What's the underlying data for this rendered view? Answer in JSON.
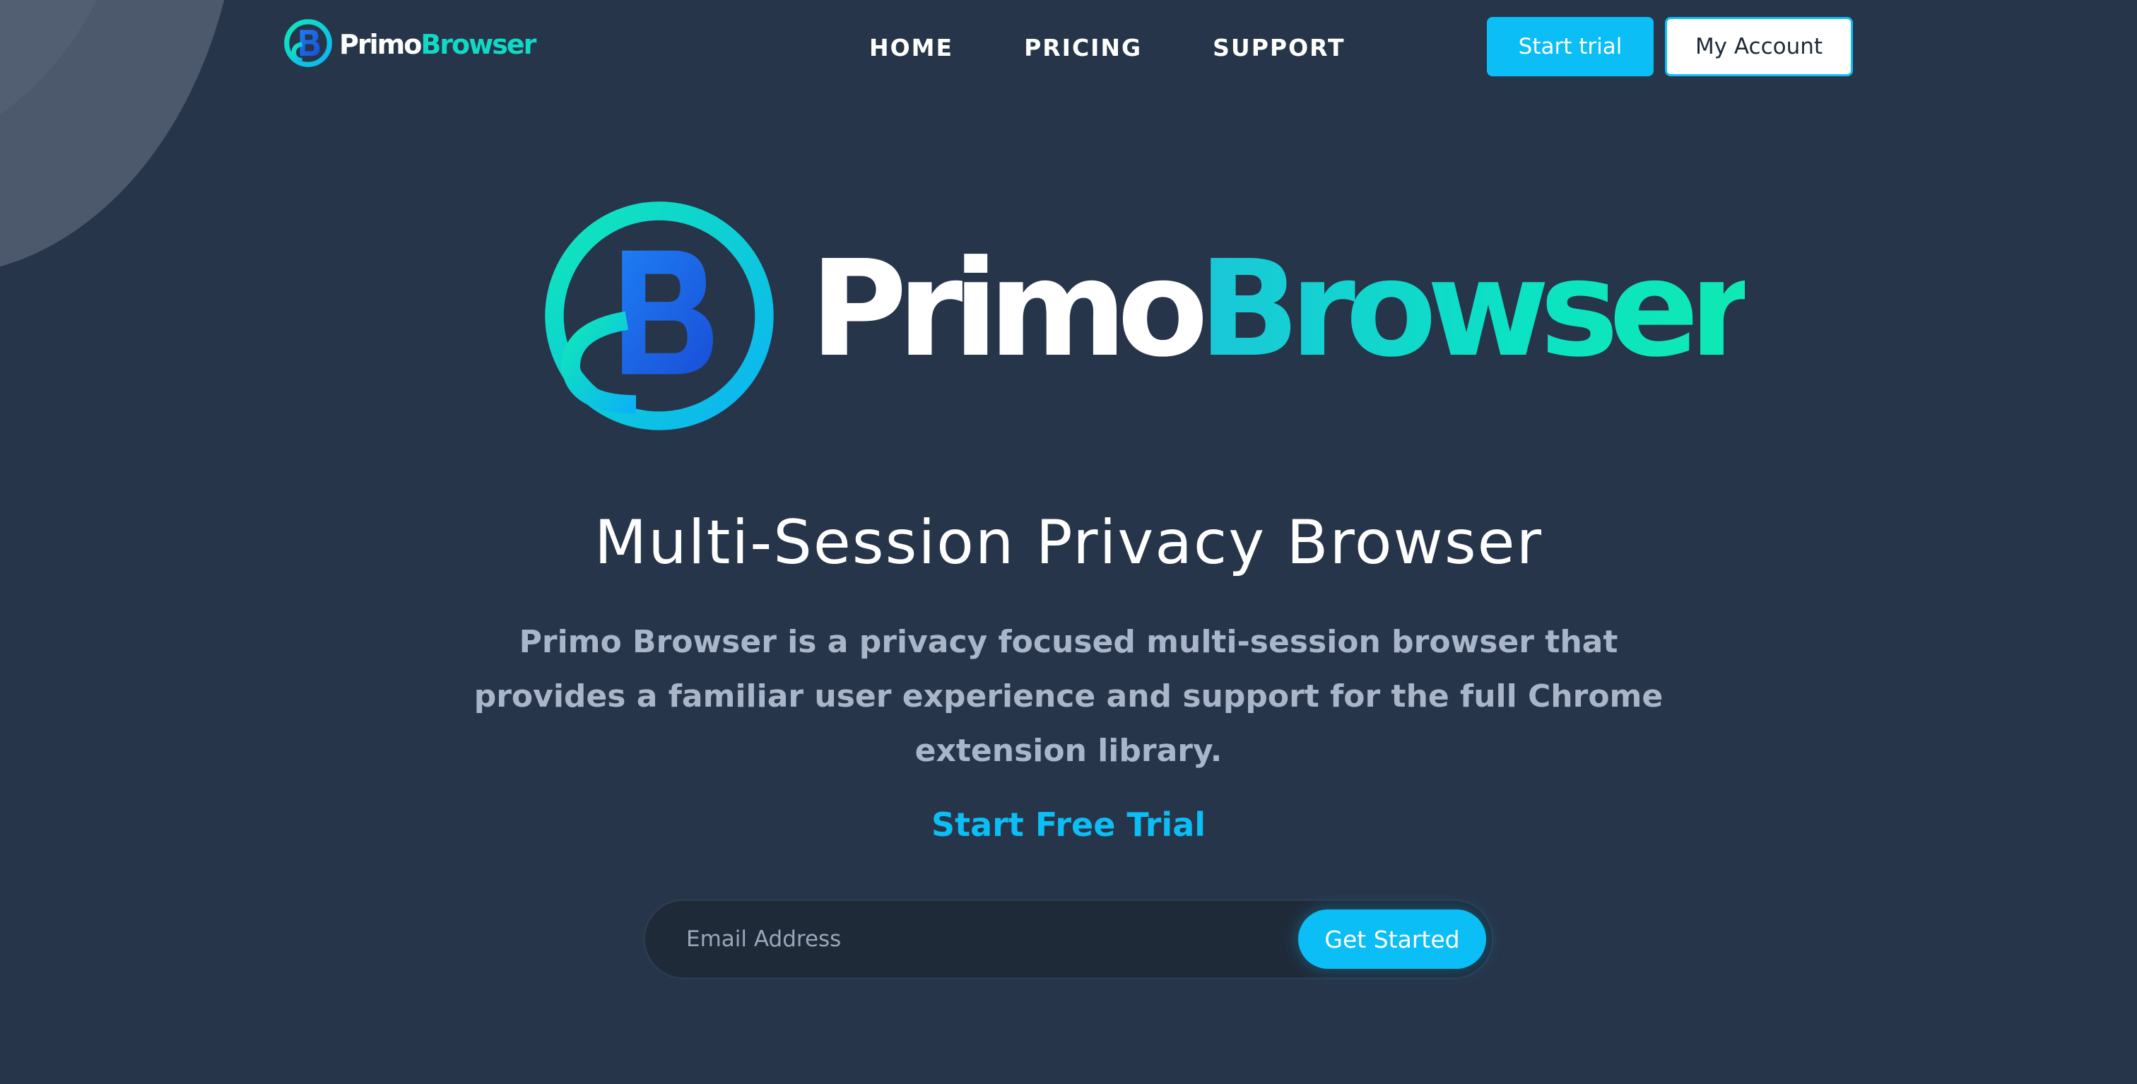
{
  "brand": {
    "name_part1": "Primo",
    "name_part2": "Browser",
    "logo_icon": "primo-b-logo-icon",
    "colors": {
      "teal": "#10d9c4",
      "blue": "#0bbef5",
      "deep_blue": "#1a56db",
      "background": "#27354a"
    }
  },
  "nav": {
    "items": [
      {
        "label": "HOME"
      },
      {
        "label": "PRICING"
      },
      {
        "label": "SUPPORT"
      }
    ]
  },
  "header_actions": {
    "start_trial_label": "Start trial",
    "my_account_label": "My Account"
  },
  "hero": {
    "headline": "Multi-Session Privacy Browser",
    "description": "Primo Browser is a privacy focused multi-session browser that provides a familiar user experience and support for the full Chrome extension library.",
    "cta_link": "Start Free Trial",
    "signup": {
      "email_placeholder": "Email Address",
      "email_value": "",
      "button_label": "Get Started"
    }
  }
}
